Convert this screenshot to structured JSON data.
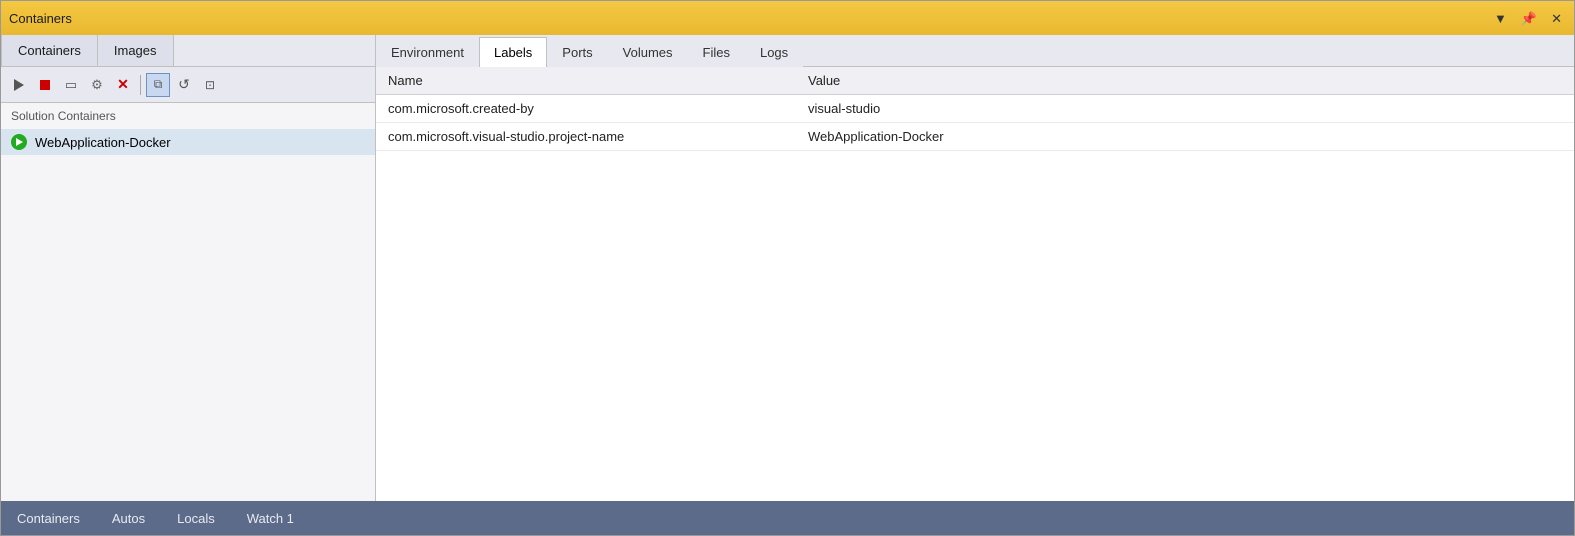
{
  "window": {
    "title": "Containers",
    "controls": {
      "dropdown": "▼",
      "pin": "📌",
      "close": "✕"
    }
  },
  "top_tabs": [
    {
      "label": "Containers",
      "active": false
    },
    {
      "label": "Images",
      "active": false
    }
  ],
  "toolbar": {
    "buttons": [
      {
        "name": "play-button",
        "icon": "▶",
        "label": "Start"
      },
      {
        "name": "stop-button",
        "icon": "■",
        "label": "Stop"
      },
      {
        "name": "terminal-button",
        "icon": "▭",
        "label": "Open Terminal"
      },
      {
        "name": "settings-button",
        "icon": "⚙",
        "label": "Settings"
      },
      {
        "name": "delete-button",
        "icon": "✕",
        "label": "Delete"
      },
      {
        "name": "copy-button",
        "icon": "⧉",
        "label": "Copy",
        "active": true
      },
      {
        "name": "refresh-button",
        "icon": "↺",
        "label": "Refresh"
      },
      {
        "name": "copy2-button",
        "icon": "⊡",
        "label": "Copy Files"
      }
    ]
  },
  "left_panel": {
    "solution_label": "Solution Containers",
    "containers": [
      {
        "name": "WebApplication-Docker",
        "status": "running"
      }
    ]
  },
  "detail_tabs": [
    {
      "label": "Environment",
      "active": false
    },
    {
      "label": "Labels",
      "active": true
    },
    {
      "label": "Ports",
      "active": false
    },
    {
      "label": "Volumes",
      "active": false
    },
    {
      "label": "Files",
      "active": false
    },
    {
      "label": "Logs",
      "active": false
    }
  ],
  "table": {
    "columns": [
      {
        "header": "Name",
        "key": "name"
      },
      {
        "header": "Value",
        "key": "value"
      }
    ],
    "rows": [
      {
        "name": "com.microsoft.created-by",
        "value": "visual-studio"
      },
      {
        "name": "com.microsoft.visual-studio.project-name",
        "value": "WebApplication-Docker"
      }
    ]
  },
  "bottom_tabs": [
    {
      "label": "Containers",
      "active": false
    },
    {
      "label": "Autos",
      "active": false
    },
    {
      "label": "Locals",
      "active": false
    },
    {
      "label": "Watch 1",
      "active": false
    }
  ]
}
